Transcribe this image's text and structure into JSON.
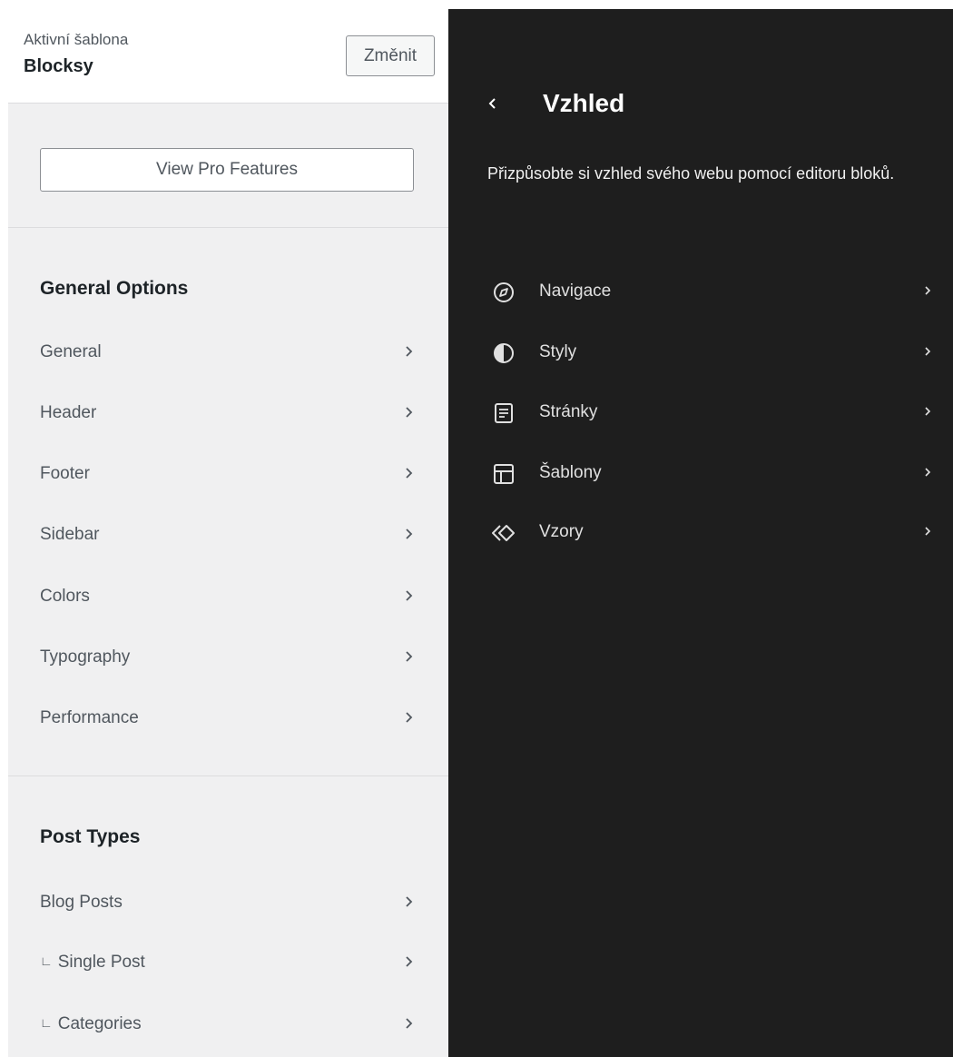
{
  "theme": {
    "active_label": "Aktivní šablona",
    "name": "Blocksy",
    "change_label": "Změnit"
  },
  "pro_button_label": "View Pro Features",
  "general_options": {
    "title": "General Options",
    "items": [
      {
        "label": "General"
      },
      {
        "label": "Header"
      },
      {
        "label": "Footer"
      },
      {
        "label": "Sidebar"
      },
      {
        "label": "Colors"
      },
      {
        "label": "Typography"
      },
      {
        "label": "Performance"
      }
    ]
  },
  "post_types": {
    "title": "Post Types",
    "items": [
      {
        "label": "Blog Posts",
        "sub": false
      },
      {
        "label": "Single Post",
        "sub": true
      },
      {
        "label": "Categories",
        "sub": true
      }
    ]
  },
  "appearance": {
    "title": "Vzhled",
    "description": "Přizpůsobte si vzhled svého webu pomocí editoru bloků.",
    "items": [
      {
        "label": "Navigace",
        "icon": "compass-icon"
      },
      {
        "label": "Styly",
        "icon": "half-circle-icon"
      },
      {
        "label": "Stránky",
        "icon": "page-icon"
      },
      {
        "label": "Šablony",
        "icon": "layout-icon"
      },
      {
        "label": "Vzory",
        "icon": "symbol-icon"
      }
    ]
  },
  "colors": {
    "left_bg": "#f0f0f1",
    "right_bg": "#1e1e1e",
    "text_muted": "#50575e"
  }
}
